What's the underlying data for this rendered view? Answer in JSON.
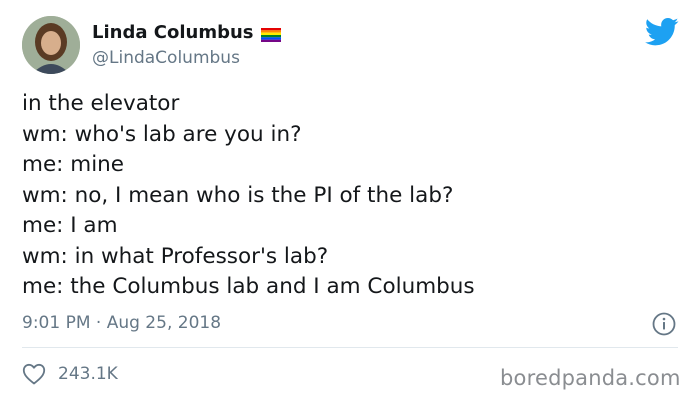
{
  "author": {
    "name": "Linda Columbus",
    "handle": "@LindaColumbus",
    "flag_icon": "rainbow-flag-icon",
    "avatar_icon": "profile-photo"
  },
  "platform_icon": "twitter-bird-icon",
  "tweet": {
    "lines": [
      "in the elevator",
      "wm: who's lab are you in?",
      "me: mine",
      "wm: no, I mean who is the PI of the lab?",
      "me: I am",
      "wm: in what Professor's lab?",
      "me: the Columbus lab and I am Columbus"
    ]
  },
  "meta": {
    "timestamp": "9:01 PM · Aug 25, 2018",
    "info_icon": "info-icon"
  },
  "engagement": {
    "like_icon": "heart-icon",
    "likes": "243.1K"
  },
  "watermark": "boredpanda.com",
  "colors": {
    "text": "#14171a",
    "secondary": "#657786",
    "twitter_blue": "#1da1f2",
    "divider": "#e1e8ed"
  }
}
